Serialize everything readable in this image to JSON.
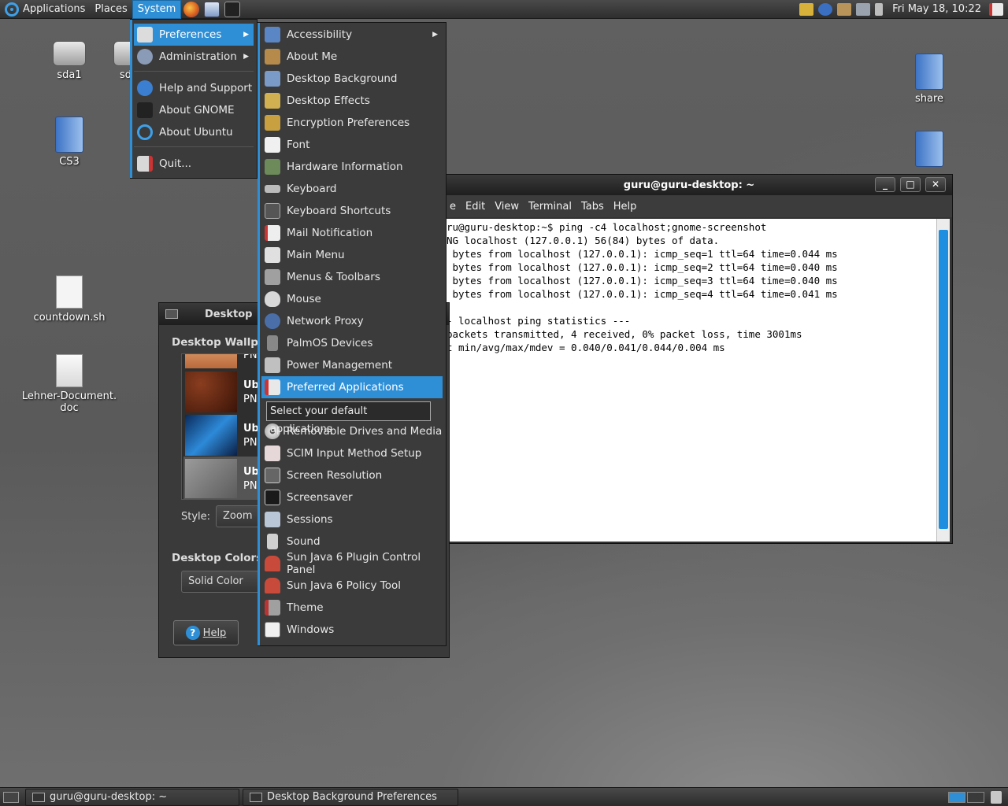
{
  "top_panel": {
    "applications": "Applications",
    "places": "Places",
    "system": "System",
    "clock": "Fri May 18, 10:22"
  },
  "desktop_icons": {
    "sda1": "sda1",
    "sd": "sd",
    "cs3": "CS3",
    "countdown": "countdown.sh",
    "lehner_line1": "Lehner-Document.",
    "lehner_line2": "doc",
    "share": "share"
  },
  "system_menu": {
    "items": [
      "Preferences",
      "Administration",
      "Help and Support",
      "About GNOME",
      "About Ubuntu",
      "Quit..."
    ]
  },
  "preferences_menu": {
    "items": [
      "Accessibility",
      "About Me",
      "Desktop Background",
      "Desktop Effects",
      "Encryption Preferences",
      "Font",
      "Hardware Information",
      "Keyboard",
      "Keyboard Shortcuts",
      "Mail Notification",
      "Main Menu",
      "Menus & Toolbars",
      "Mouse",
      "Network Proxy",
      "PalmOS Devices",
      "Power Management",
      "Preferred Applications",
      "Removable Drives and Media",
      "SCIM Input Method Setup",
      "Screen Resolution",
      "Screensaver",
      "Sessions",
      "Sound",
      "Sun Java 6 Plugin Control Panel",
      "Sun Java 6 Policy Tool",
      "Theme",
      "Windows"
    ]
  },
  "tooltip": "Select your default applications",
  "terminal": {
    "title": "guru@guru-desktop: ~",
    "menu": [
      "e",
      "Edit",
      "View",
      "Terminal",
      "Tabs",
      "Help"
    ],
    "lines": [
      "ru@guru-desktop:~$ ping -c4 localhost;gnome-screenshot",
      "NG localhost (127.0.0.1) 56(84) bytes of data.",
      " bytes from localhost (127.0.0.1): icmp_seq=1 ttl=64 time=0.044 ms",
      " bytes from localhost (127.0.0.1): icmp_seq=2 ttl=64 time=0.040 ms",
      " bytes from localhost (127.0.0.1): icmp_seq=3 ttl=64 time=0.040 ms",
      " bytes from localhost (127.0.0.1): icmp_seq=4 ttl=64 time=0.041 ms",
      "",
      "- localhost ping statistics ---",
      "packets transmitted, 4 received, 0% packet loss, time 3001ms",
      "t min/avg/max/mdev = 0.040/0.041/0.044/0.004 ms"
    ]
  },
  "bg_prefs": {
    "title": "Desktop",
    "wallpaper_heading": "Desktop Wallp",
    "thumb_labels": [
      {
        "name": "Ub",
        "type": "PN"
      },
      {
        "name": "Ub",
        "type": "PN"
      },
      {
        "name": "Ub",
        "type": "PN"
      }
    ],
    "top_partial_type": "PN",
    "style_label": "Style:",
    "style_value": "Zoom",
    "colors_heading": "Desktop Colors",
    "color_value": "Solid Color",
    "help_button": "Help"
  },
  "bottom_panel": {
    "task_terminal": "guru@guru-desktop: ~",
    "task_bgprefs": "Desktop Background Preferences"
  },
  "colors": {
    "highlight": "#2e8fd6"
  }
}
